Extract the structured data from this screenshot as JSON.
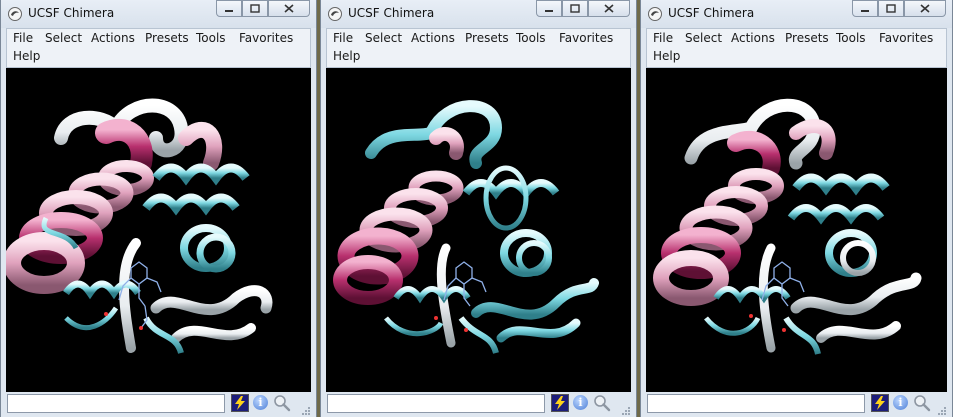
{
  "windows": [
    {
      "title": "UCSF Chimera",
      "menu_row1": [
        "File",
        "Select",
        "Actions",
        "Presets",
        "Tools",
        "Favorites"
      ],
      "menu_row2": [
        "Help"
      ],
      "command_value": ""
    },
    {
      "title": "UCSF Chimera",
      "menu_row1": [
        "File",
        "Select",
        "Actions",
        "Presets",
        "Tools",
        "Favorites"
      ],
      "menu_row2": [
        "Help"
      ],
      "command_value": ""
    },
    {
      "title": "UCSF Chimera",
      "menu_row1": [
        "File",
        "Select",
        "Actions",
        "Presets",
        "Tools",
        "Favorites"
      ],
      "menu_row2": [
        "Help"
      ],
      "command_value": ""
    }
  ],
  "icons": {
    "app": "chimera-app-icon",
    "minimize": "minimize-icon",
    "maximize": "maximize-icon",
    "close": "close-icon",
    "command_exec": "lightning-bolt-icon",
    "info": "info-icon",
    "magnify": "magnifier-icon"
  },
  "info_glyph": "i",
  "colors": {
    "viewer_bg": "#000000",
    "helix_magenta": "#b8306e",
    "helix_pink": "#e0a2bd",
    "helix_cyan": "#7ed8e2",
    "coil_white": "#eef2f4",
    "titlebar": "#dfe7f0"
  }
}
